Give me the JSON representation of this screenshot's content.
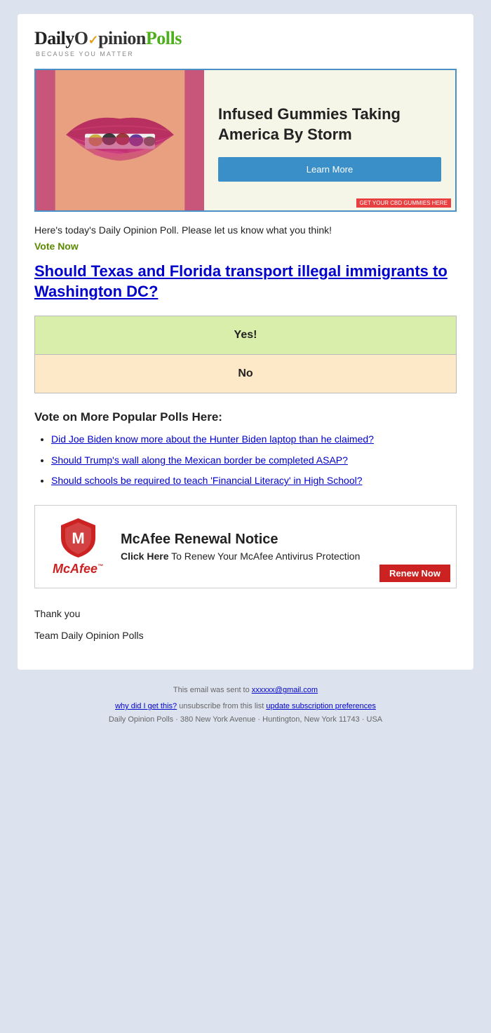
{
  "logo": {
    "daily": "Daily",
    "opinion": "pinion",
    "o_check": "✓",
    "polls": "Polls",
    "tagline": "Because You Matter"
  },
  "ad_banner": {
    "headline": "Infused Gummies Taking America By Storm",
    "learn_btn": "Learn More",
    "bottom_label": "Get Your CBD Gummies Here"
  },
  "intro": {
    "text": "Here's today's Daily Opinion Poll. Please let us know what you think!",
    "vote_now": "Vote Now"
  },
  "poll": {
    "question": "Should Texas and Florida transport illegal immigrants to Washington DC?"
  },
  "vote_options": {
    "yes": "Yes!",
    "no": "No"
  },
  "more_polls": {
    "heading": "Vote on More Popular Polls Here:",
    "items": [
      "Did Joe Biden know more about the Hunter Biden laptop than he claimed?",
      "Should Trump's wall along the Mexican border be completed ASAP?",
      "Should schools be required to teach 'Financial Literacy' in High School?"
    ]
  },
  "mcafee": {
    "title": "McAfee Renewal Notice",
    "desc_prefix": "Click Here",
    "desc_suffix": " To Renew Your McAfee Antivirus Protection",
    "renew_btn": "Renew Now",
    "name": "McAfee",
    "tm": "™"
  },
  "email_closing": {
    "thank_you": "Thank you",
    "team": "Team Daily Opinion Polls"
  },
  "footer": {
    "line1": "This email was sent to",
    "email": "xxxxxx@gmail.com",
    "line2_prefix": "why did I get this?",
    "line2_mid": " unsubscribe from this list ",
    "line2_link": "update subscription preferences",
    "line3": "Daily Opinion Polls · 380 New York Avenue · Huntington, New York 11743 · USA"
  }
}
